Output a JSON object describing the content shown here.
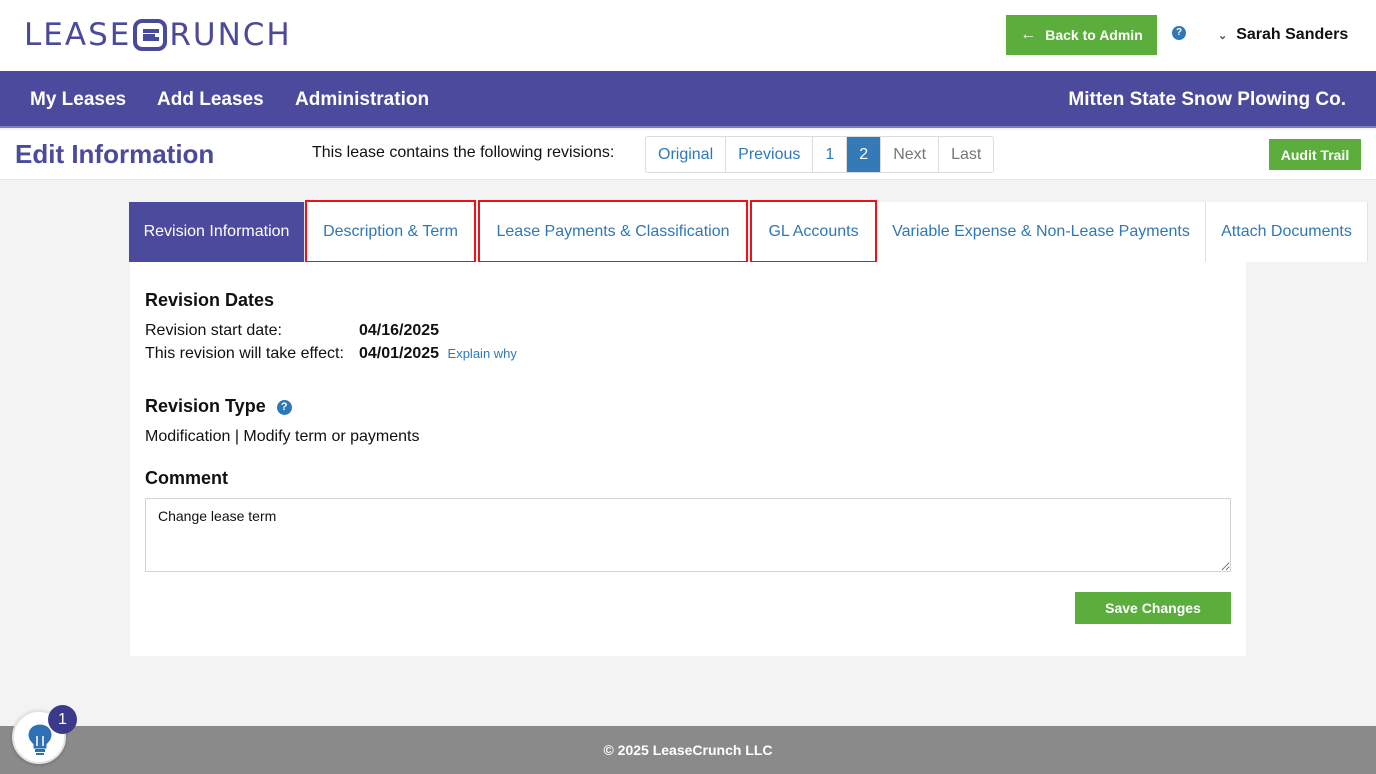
{
  "header": {
    "logo_left": "LEASE",
    "logo_right": "RUNCH",
    "back_label": "Back to Admin",
    "help": "?",
    "user": "Sarah Sanders"
  },
  "nav": {
    "items": [
      {
        "label": "My Leases"
      },
      {
        "label": "Add Leases"
      },
      {
        "label": "Administration"
      }
    ],
    "company": "Mitten State Snow Plowing Co."
  },
  "subheader": {
    "title": "Edit Information",
    "revisions_text": "This lease contains the following revisions:",
    "pager": [
      {
        "label": "Original"
      },
      {
        "label": "Previous"
      },
      {
        "label": "1"
      },
      {
        "label": "2"
      },
      {
        "label": "Next"
      },
      {
        "label": "Last"
      }
    ],
    "audit_label": "Audit Trail"
  },
  "tabs": [
    {
      "label": "Revision Information"
    },
    {
      "label": "Description & Term"
    },
    {
      "label": "Lease Payments & Classification"
    },
    {
      "label": "GL Accounts"
    },
    {
      "label": "Variable Expense & Non-Lease Payments"
    },
    {
      "label": "Attach Documents"
    }
  ],
  "colors": {
    "brand": "#4b4a9c",
    "accent_green": "#5bad3c",
    "link_blue": "#2f78b8",
    "highlight_red": "#e8141b"
  },
  "panel": {
    "dates_heading": "Revision Dates",
    "start_label": "Revision start date:",
    "start_value": "04/16/2025",
    "effect_label": "This revision will take effect:",
    "effect_value": "04/01/2025",
    "explain": "Explain why",
    "type_heading": "Revision Type",
    "type_value": "Modification | Modify term or payments",
    "comment_heading": "Comment",
    "comment_value": "Change lease term",
    "save_label": "Save Changes"
  },
  "footer": {
    "text": "©  2025 LeaseCrunch LLC"
  },
  "helper": {
    "badge": "1"
  }
}
